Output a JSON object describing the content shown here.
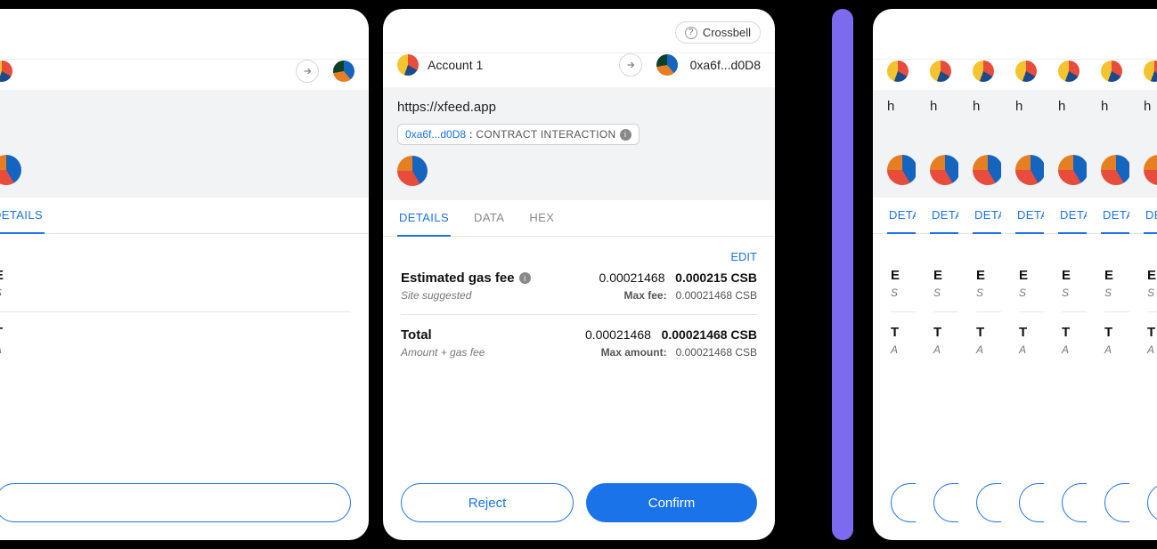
{
  "header": {
    "network_label": "Crossbell"
  },
  "accounts": {
    "from_label": "Account 1",
    "to_address": "0xa6f...d0D8"
  },
  "info": {
    "url": "https://xfeed.app",
    "chip_address": "0xa6f...d0D8",
    "chip_separator": " : ",
    "chip_label": "CONTRACT INTERACTION"
  },
  "tabs": {
    "details": "DETAILS",
    "data": "DATA",
    "hex": "HEX"
  },
  "details": {
    "edit_label": "EDIT",
    "gas_title": "Estimated gas fee",
    "gas_value_left": "0.00021468",
    "gas_value_right": "0.000215 CSB",
    "gas_sub_left": "Site suggested",
    "gas_max_key": "Max fee:",
    "gas_max_val": "0.00021468 CSB",
    "total_title": "Total",
    "total_value_left": "0.00021468",
    "total_value_right": "0.00021468 CSB",
    "total_sub_left": "Amount + gas fee",
    "total_max_key": "Max amount:",
    "total_max_val": "0.00021468 CSB"
  },
  "buttons": {
    "reject": "Reject",
    "confirm": "Confirm"
  }
}
